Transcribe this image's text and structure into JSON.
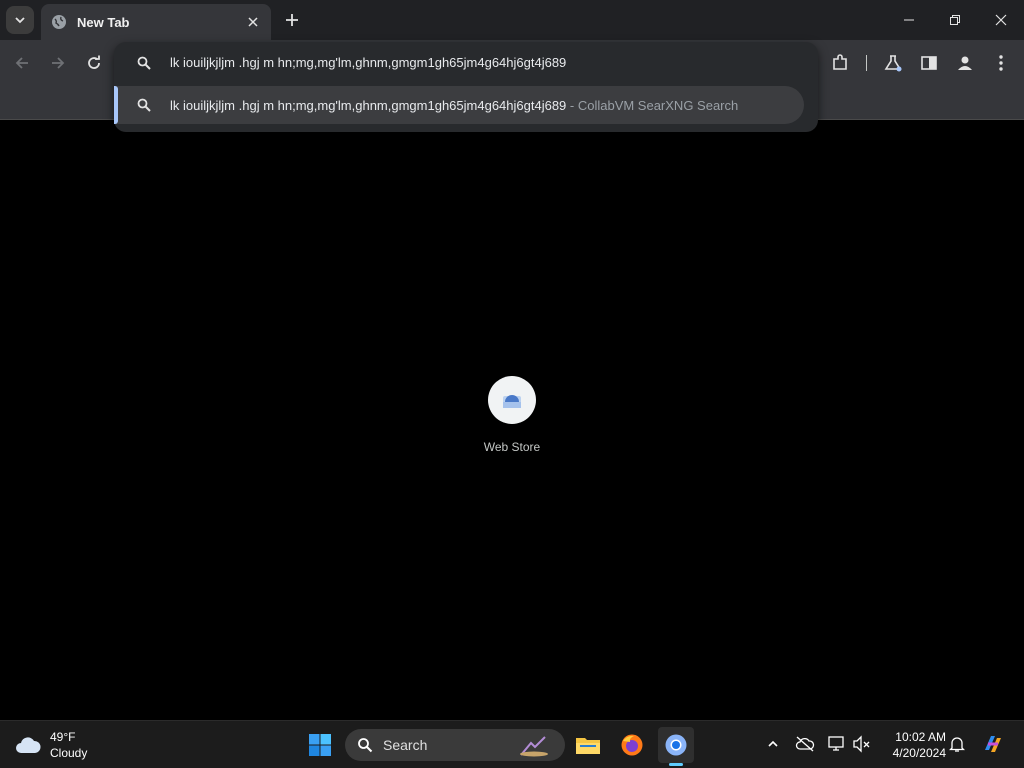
{
  "browser": {
    "tab": {
      "title": "New Tab"
    },
    "omnibox": {
      "text": "lk iouiljkjljm .hgj m hn;mg,mg'lm,ghnm,gmgm1gh65jm4g64hj6gt4j689",
      "suggestion": {
        "text": "lk iouiljkjljm .hgj m hn;mg,mg'lm,ghnm,gmgm1gh65jm4g64hj6gt4j689",
        "engine": " - CollabVM SearXNG Search"
      }
    },
    "shortcuts": [
      {
        "label": "Web Store"
      }
    ]
  },
  "taskbar": {
    "weather": {
      "temp": "49°F",
      "condition": "Cloudy"
    },
    "search_label": "Search",
    "clock": {
      "time": "10:02 AM",
      "date": "4/20/2024"
    }
  },
  "colors": {
    "accent": "#a8c7fa",
    "taskbar_indicator": "#60cdff",
    "tab_active": "#35363a",
    "background": "#000000"
  }
}
